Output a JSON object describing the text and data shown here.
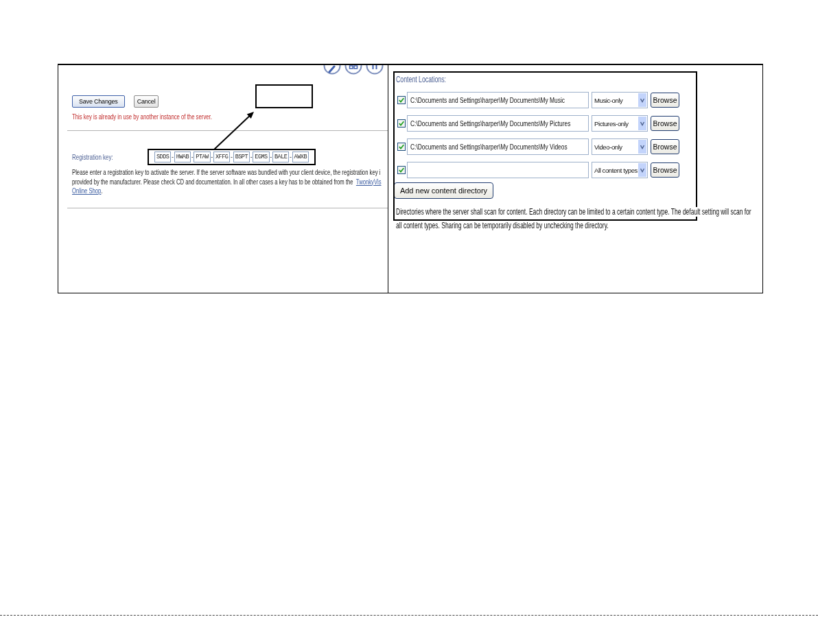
{
  "left_panel": {
    "buttons": [
      {
        "label": "Save Changes",
        "kind": "primary"
      },
      {
        "label": "Cancel",
        "kind": "secondary"
      }
    ],
    "error": "This key is already in use by another instance of the server.",
    "registration": {
      "label": "Registration key:",
      "fields": [
        {
          "value": "SDDS",
          "separator": "-"
        },
        {
          "value": "HWAB",
          "separator": "-"
        },
        {
          "value": "PTAW",
          "separator": "-"
        },
        {
          "value": "XFFG",
          "separator": "-"
        },
        {
          "value": "BSPT",
          "separator": "-"
        },
        {
          "value": "EGMS",
          "separator": "-"
        },
        {
          "value": "BALE",
          "separator": "-"
        },
        {
          "value": "AWXB"
        }
      ]
    },
    "help": {
      "lines": [
        {
          "text": "Please enter a registration key to activate the server. If the server software was bundled with your client device, the registration key i"
        },
        {
          "text": "provided by the manufacturer. Please check CD and documentation. In all other cases a key has to be obtained from the ",
          "link": "TwonkyVis"
        },
        {
          "link": "Online Shop",
          "after": "."
        }
      ]
    }
  },
  "right_panel": {
    "title": "Content Locations:",
    "rows": [
      {
        "checked": true,
        "path": "C:\\Documents and Settings\\harper\\My Documents\\My Music",
        "type": "Music-only",
        "button": "Browse"
      },
      {
        "checked": true,
        "path": "C:\\Documents and Settings\\harper\\My Documents\\My Pictures",
        "type": "Pictures-only",
        "button": "Browse"
      },
      {
        "checked": true,
        "path": "C:\\Documents and Settings\\harper\\My Documents\\My Videos",
        "type": "Video-only",
        "button": "Browse"
      },
      {
        "checked": true,
        "type": "All content types",
        "button": "Browse"
      }
    ],
    "add_button": "Add new content directory",
    "description": {
      "lines": [
        "Directories where the server shall scan for content. Each directory can be limited to a certain content type. The default setting will scan for",
        "all content types. Sharing can be temporarily disabled by unchecking the directory."
      ]
    }
  }
}
